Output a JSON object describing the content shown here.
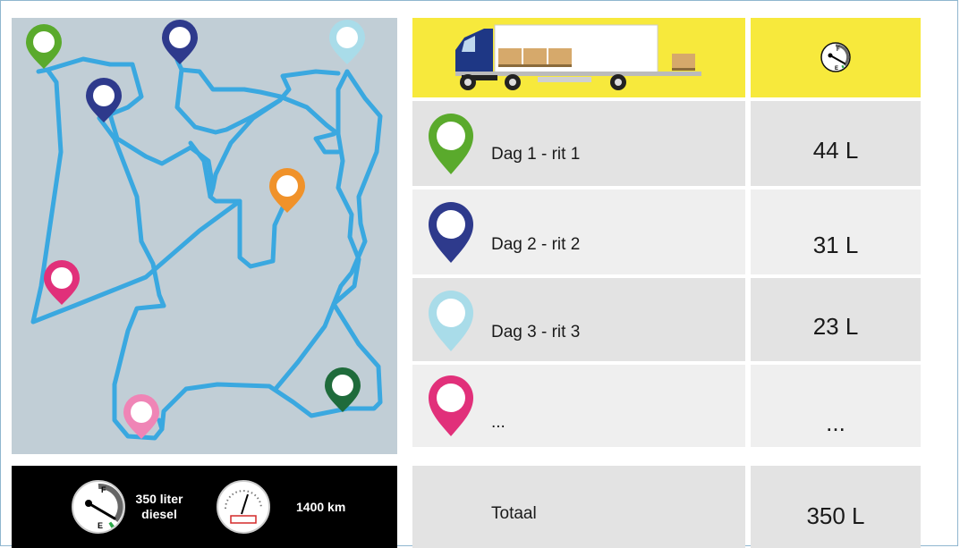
{
  "rows": [
    {
      "label": "Dag 1 - rit 1",
      "value": "44 L",
      "pin_color": "#5aaa2c"
    },
    {
      "label": "Dag 2 - rit 2",
      "value": "31 L",
      "pin_color": "#2e3a8c"
    },
    {
      "label": "Dag 3 - rit 3",
      "value": "23 L",
      "pin_color": "#a9dce9"
    },
    {
      "label": "...",
      "value": "...",
      "pin_color": "#e1307a"
    }
  ],
  "total": {
    "label": "Totaal",
    "value": "350 L"
  },
  "summary": {
    "fuel_line1": "350 liter",
    "fuel_line2": "diesel",
    "distance": "1400 km"
  },
  "gauges": {
    "full_mark": "F",
    "empty_mark": "E"
  },
  "colors": {
    "header_yellow": "#f7e93c",
    "route_blue": "#3aa8e0",
    "map_bg": "#c1ced6",
    "bar_bg": "#000000"
  },
  "map_pins": [
    {
      "color": "#5aaa2c",
      "name": "green"
    },
    {
      "color": "#2e3a8c",
      "name": "navy-top"
    },
    {
      "color": "#a9dce9",
      "name": "lightblue"
    },
    {
      "color": "#2e3a8c",
      "name": "navy-left"
    },
    {
      "color": "#f0922a",
      "name": "orange"
    },
    {
      "color": "#e1307a",
      "name": "pink"
    },
    {
      "color": "#1f6b3b",
      "name": "darkgreen"
    },
    {
      "color": "#ef85b6",
      "name": "lightpink"
    }
  ]
}
